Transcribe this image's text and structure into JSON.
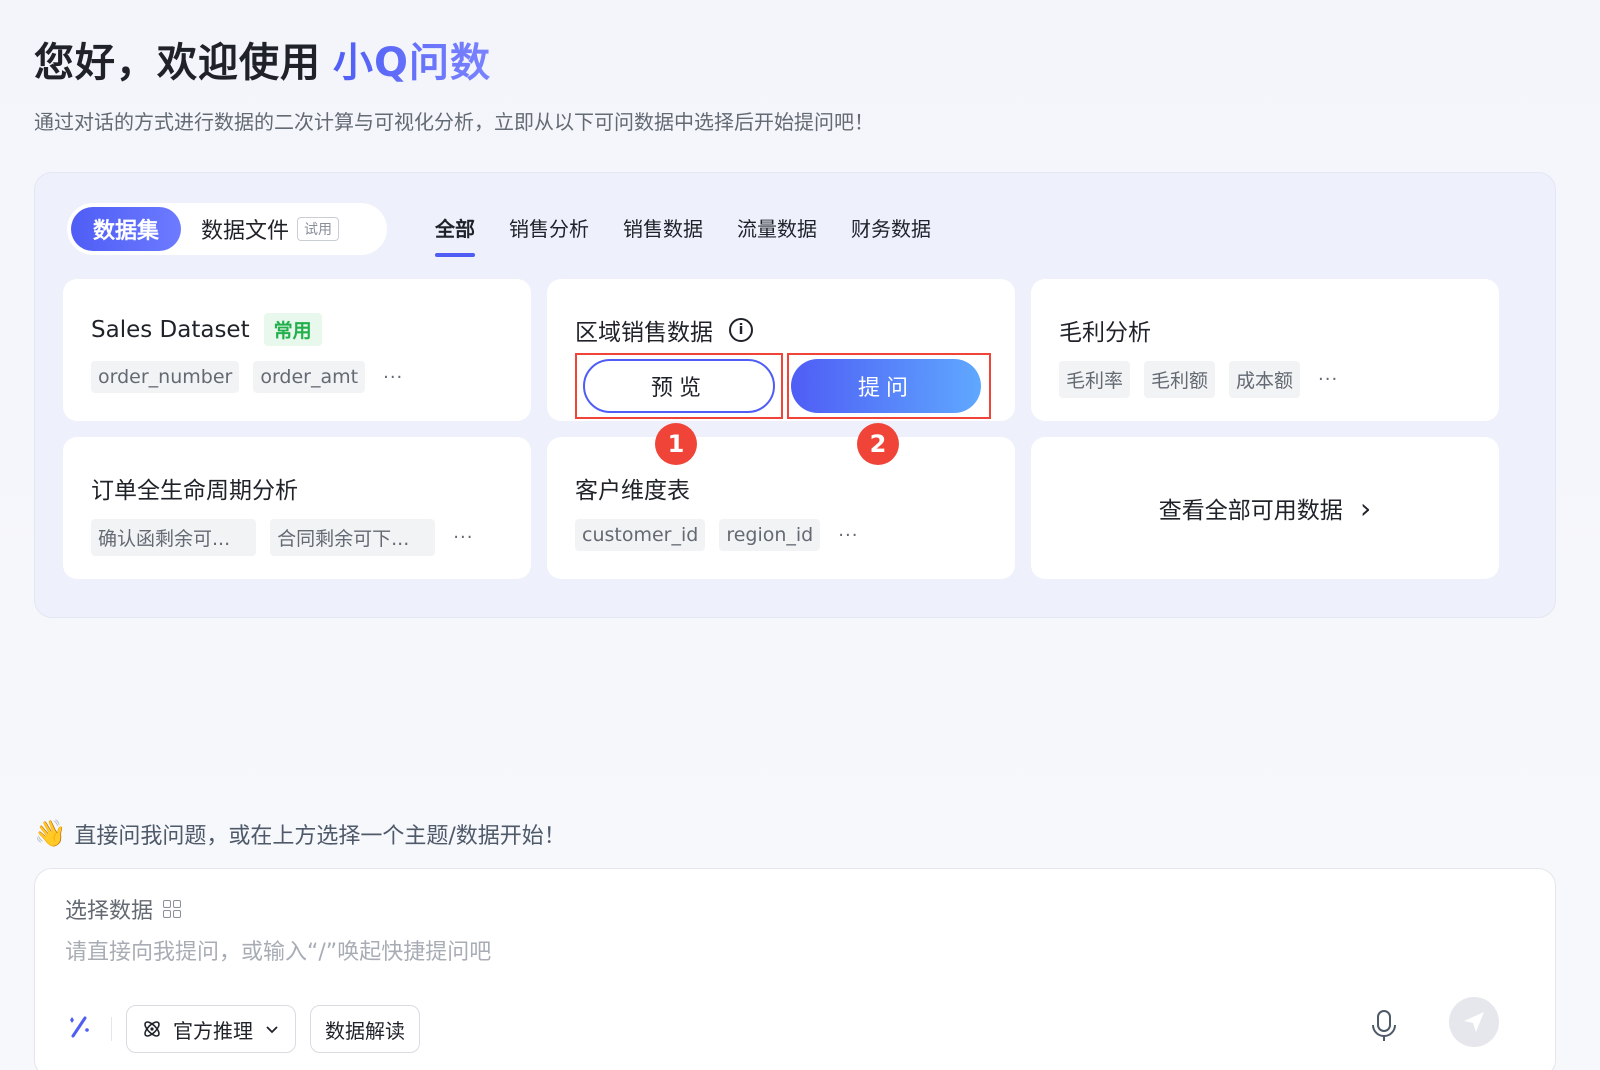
{
  "header": {
    "greeting": "您好，欢迎使用",
    "brand": "小Q问数",
    "subtitle": "通过对话的方式进行数据的二次计算与可视化分析，立即从以下可问数据中选择后开始提问吧！"
  },
  "type_switch": {
    "active": "数据集",
    "inactive": "数据文件",
    "trial_badge": "试用"
  },
  "category_tabs": [
    "全部",
    "销售分析",
    "销售数据",
    "流量数据",
    "财务数据"
  ],
  "cards": {
    "sales": {
      "title": "Sales Dataset",
      "tag": "常用",
      "fields": [
        "order_number",
        "order_amt"
      ],
      "more": "···"
    },
    "region": {
      "title": "区域销售数据",
      "preview_label": "预览",
      "ask_label": "提问"
    },
    "margin": {
      "title": "毛利分析",
      "fields": [
        "毛利率",
        "毛利额",
        "成本额"
      ],
      "more": "···"
    },
    "order_lifecycle": {
      "title": "订单全生命周期分析",
      "fields": [
        "确认函剩余可...",
        "合同剩余可下..."
      ],
      "more": "···"
    },
    "customer": {
      "title": "客户维度表",
      "fields": [
        "customer_id",
        "region_id"
      ],
      "more": "···"
    },
    "view_all": {
      "label": "查看全部可用数据",
      "chevron": "›"
    }
  },
  "markers": [
    "1",
    "2"
  ],
  "hint": {
    "icon": "👋",
    "text": "直接问我问题，或在上方选择一个主题/数据开始！"
  },
  "composer": {
    "select_data_label": "选择数据",
    "placeholder": "请直接向我提问，或输入“/”唤起快捷提问吧",
    "model_label": "官方推理",
    "interpret_label": "数据解读"
  },
  "colors": {
    "accent": "#4f5df5",
    "annotation": "#f04438",
    "tag_green": "#21b04b"
  }
}
